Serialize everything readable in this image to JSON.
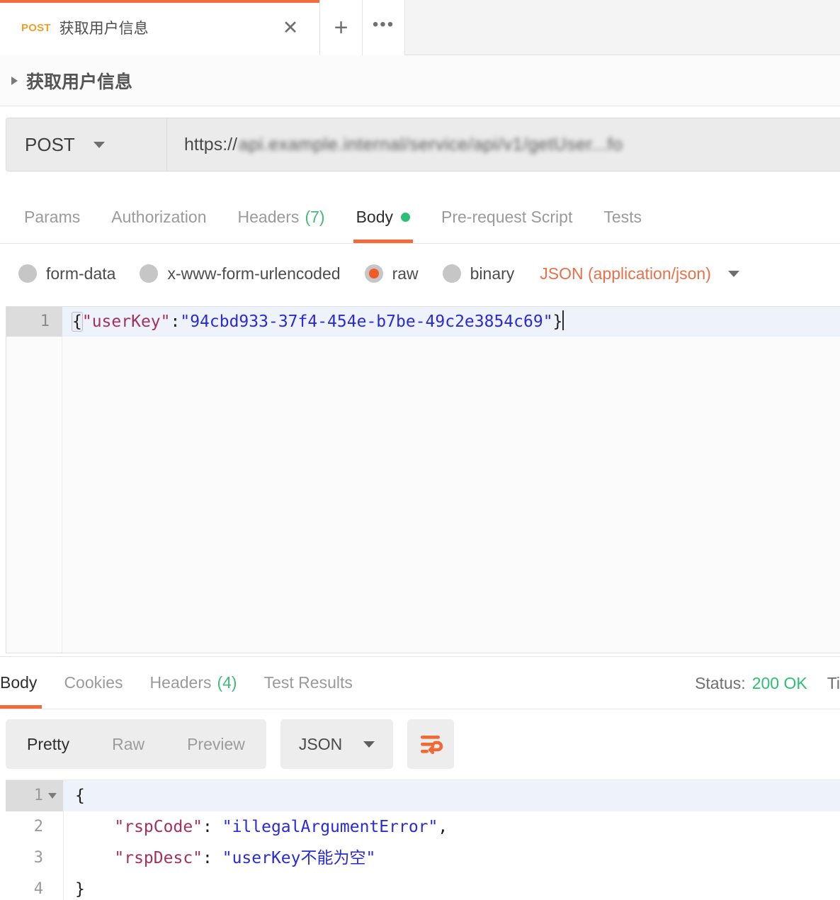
{
  "tab": {
    "method": "POST",
    "title": "获取用户信息",
    "close_icon": "close-icon",
    "new_tab_icon": "plus-icon",
    "more_icon": "ellipsis-icon"
  },
  "request_name": {
    "caret_icon": "chevron-right-icon",
    "title": "获取用户信息"
  },
  "url_bar": {
    "method": "POST",
    "method_caret_icon": "chevron-down-icon",
    "url_protocol": "https://",
    "url_redacted": "api.example.internal/service/api/v1/getUser...fo"
  },
  "request_tabs": [
    {
      "label": "Params",
      "active": false
    },
    {
      "label": "Authorization",
      "active": false
    },
    {
      "label": "Headers",
      "count": "(7)",
      "active": false
    },
    {
      "label": "Body",
      "active": true,
      "dot": true
    },
    {
      "label": "Pre-request Script",
      "active": false
    },
    {
      "label": "Tests",
      "active": false
    }
  ],
  "body_types": [
    {
      "label": "form-data",
      "selected": false
    },
    {
      "label": "x-www-form-urlencoded",
      "selected": false
    },
    {
      "label": "raw",
      "selected": true
    },
    {
      "label": "binary",
      "selected": false
    }
  ],
  "content_type": {
    "label": "JSON (application/json)",
    "caret_icon": "chevron-down-icon"
  },
  "request_body": {
    "line_number": "1",
    "open_brace": "{",
    "key": "\"userKey\"",
    "colon": ":",
    "value": "\"94cbd933-37f4-454e-b7be-49c2e3854c69\"",
    "close_brace": "}"
  },
  "response_tabs": [
    {
      "label": "Body",
      "active": true
    },
    {
      "label": "Cookies",
      "active": false
    },
    {
      "label": "Headers",
      "count": "(4)",
      "active": false
    },
    {
      "label": "Test Results",
      "active": false
    }
  ],
  "response_meta": {
    "status_label": "Status:",
    "status_value": "200 OK",
    "time_label": "Ti"
  },
  "response_toolbar": {
    "views": [
      {
        "label": "Pretty",
        "active": true
      },
      {
        "label": "Raw",
        "active": false
      },
      {
        "label": "Preview",
        "active": false
      }
    ],
    "format": "JSON",
    "format_caret_icon": "chevron-down-icon",
    "wrap_icon": "word-wrap-icon"
  },
  "response_body": {
    "lines": [
      {
        "num": "1",
        "fold": true,
        "indent": "",
        "brace": "{"
      },
      {
        "num": "2",
        "fold": false,
        "indent": "    ",
        "key": "\"rspCode\"",
        "colon": ": ",
        "value": "\"illegalArgumentError\"",
        "comma": ","
      },
      {
        "num": "3",
        "fold": false,
        "indent": "    ",
        "key": "\"rspDesc\"",
        "colon": ": ",
        "value": "\"userKey不能为空\"",
        "comma": ""
      },
      {
        "num": "4",
        "fold": false,
        "indent": "",
        "brace": "}"
      }
    ]
  },
  "colors": {
    "accent_orange": "#f26b3a",
    "method_amber": "#eda12a",
    "green_status": "#2dbf72",
    "json_key": "#a4315c",
    "json_string": "#2a2ad6",
    "content_type": "#e8704a"
  }
}
